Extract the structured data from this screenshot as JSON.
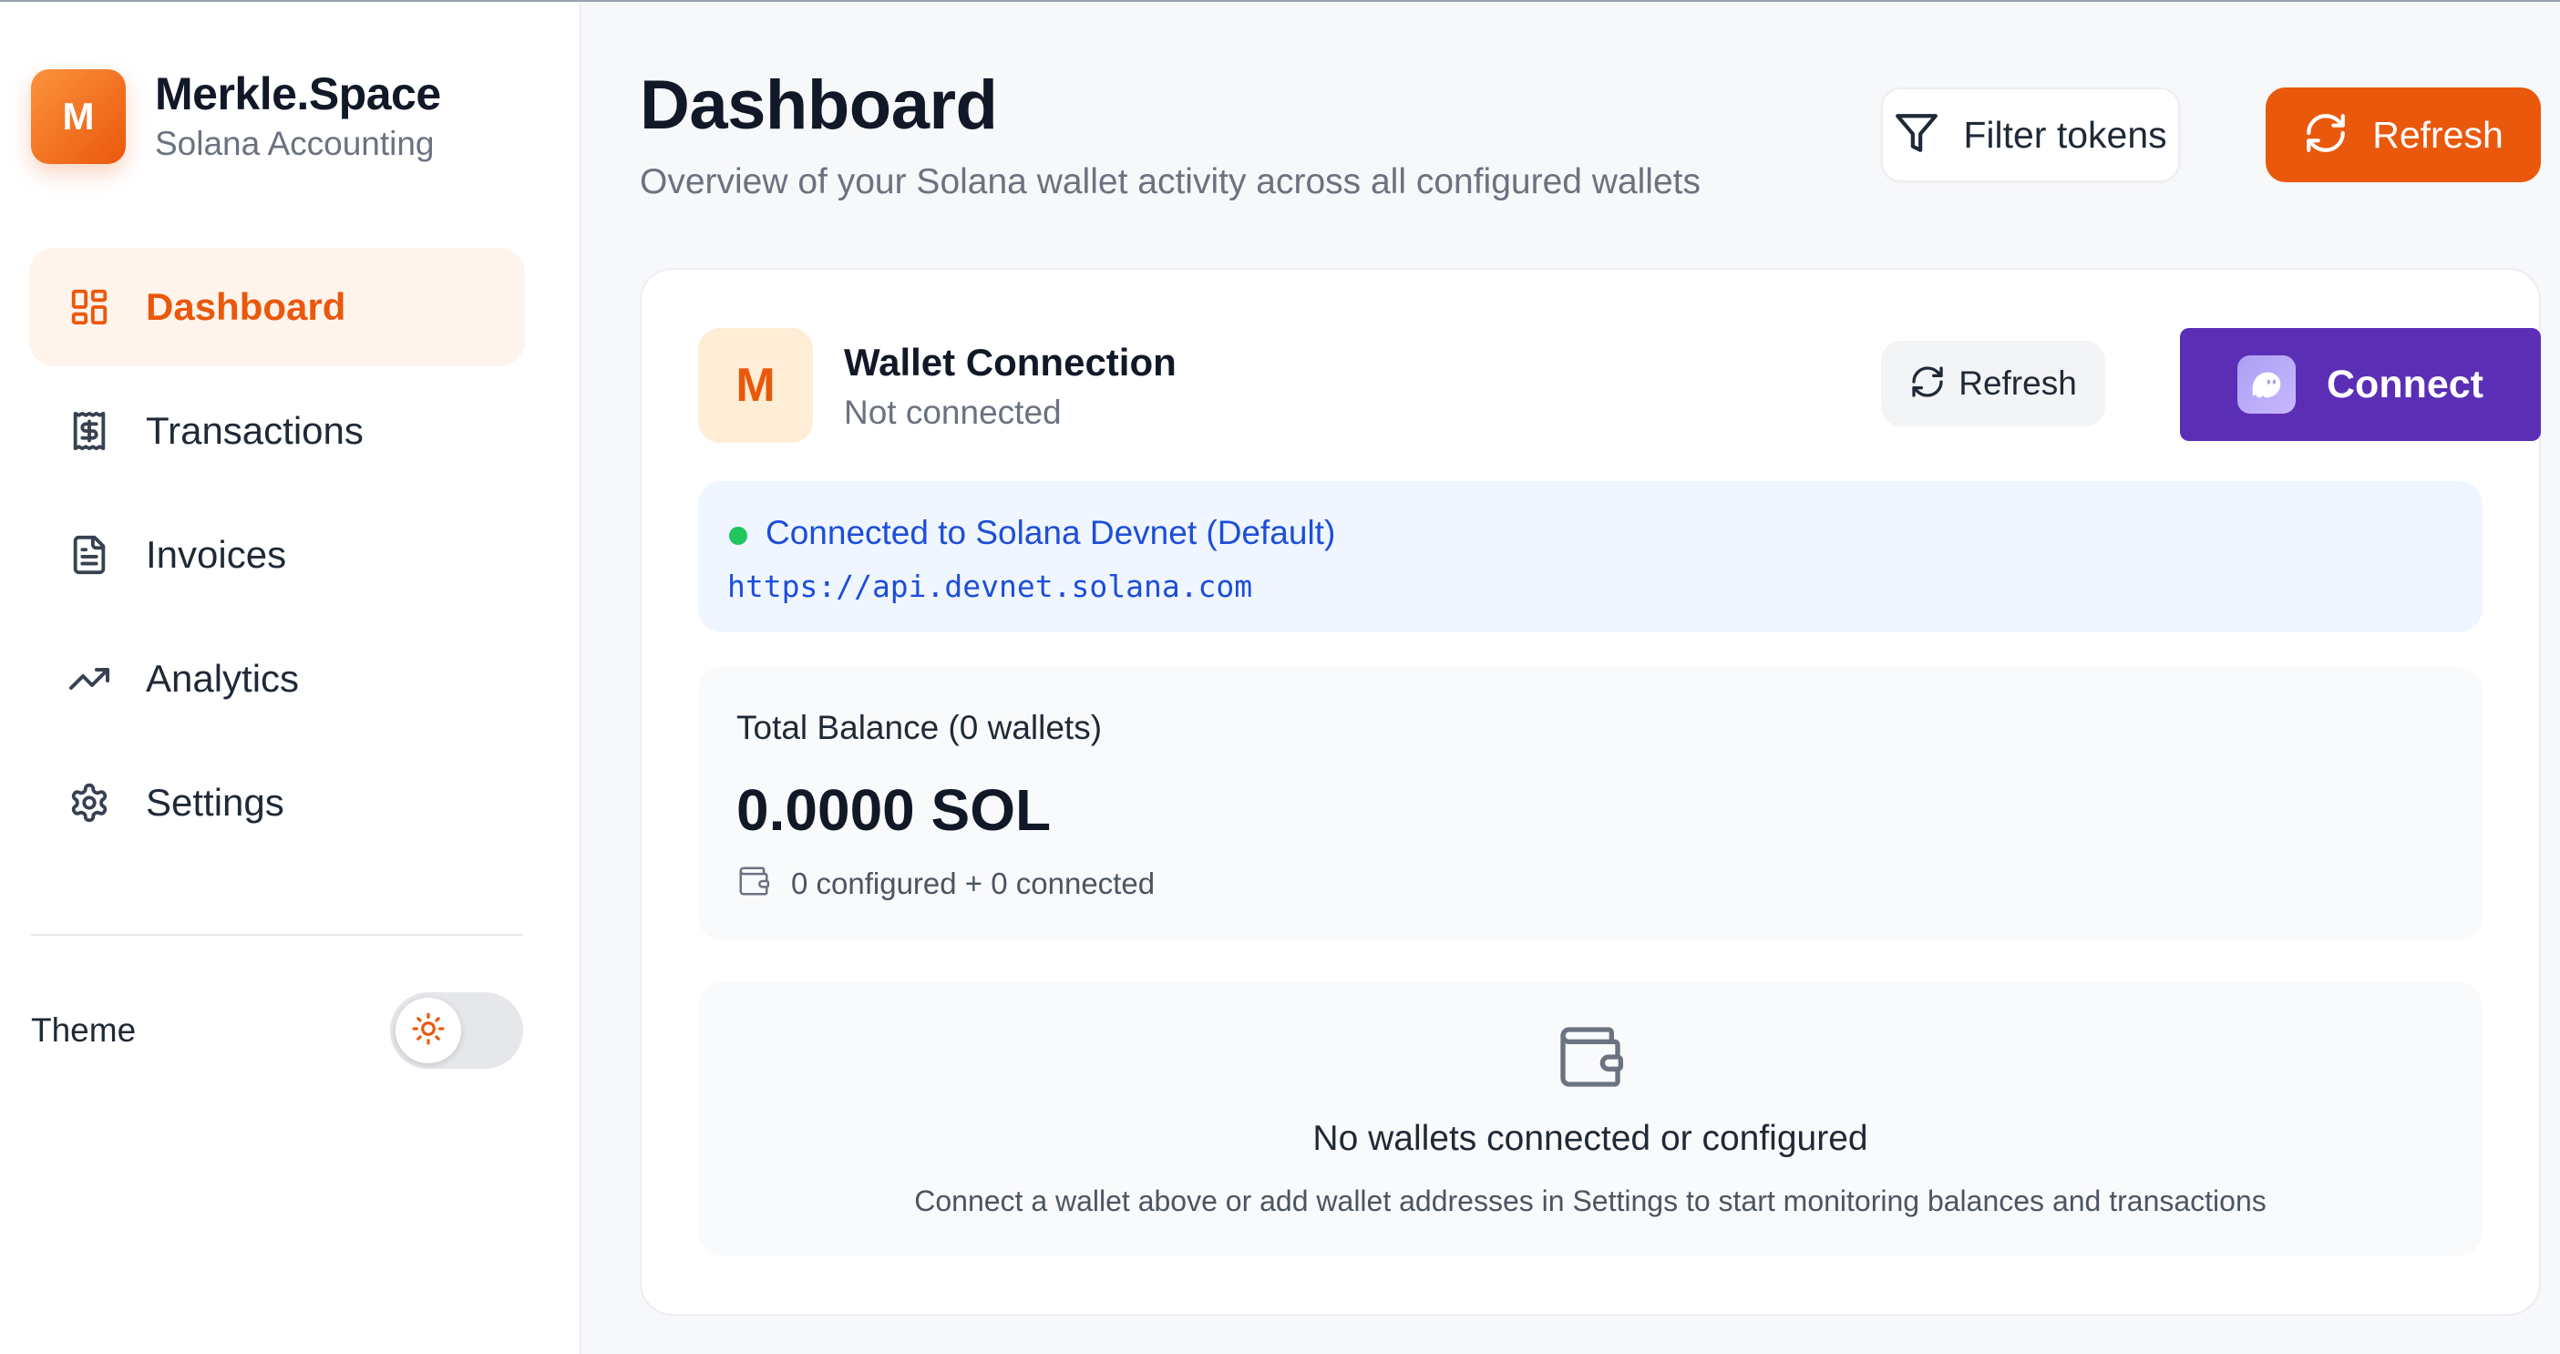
{
  "brand": {
    "logo_letter": "M",
    "title": "Merkle.Space",
    "subtitle": "Solana Accounting"
  },
  "sidebar": {
    "items": [
      {
        "label": "Dashboard",
        "icon": "dashboard-grid-icon",
        "active": true
      },
      {
        "label": "Transactions",
        "icon": "receipt-dollar-icon",
        "active": false
      },
      {
        "label": "Invoices",
        "icon": "document-icon",
        "active": false
      },
      {
        "label": "Analytics",
        "icon": "trending-up-icon",
        "active": false
      },
      {
        "label": "Settings",
        "icon": "gear-icon",
        "active": false
      }
    ],
    "theme_label": "Theme",
    "theme_icon": "sun-icon"
  },
  "header": {
    "title": "Dashboard",
    "subtitle": "Overview of your Solana wallet activity across all configured wallets",
    "filter_label": "Filter tokens",
    "refresh_label": "Refresh"
  },
  "wallet": {
    "avatar_letter": "M",
    "title": "Wallet Connection",
    "status": "Not connected",
    "refresh_label": "Refresh",
    "connect_label": "Connect"
  },
  "network": {
    "name": "Connected to Solana Devnet (Default)",
    "url": "https://api.devnet.solana.com",
    "status_color": "#22c55e"
  },
  "balance": {
    "label": "Total Balance (0 wallets)",
    "value": "0.0000 SOL",
    "meta": "0 configured + 0 connected"
  },
  "empty": {
    "title": "No wallets connected or configured",
    "text": "Connect a wallet above or add wallet addresses in Settings to start monitoring balances and transactions"
  },
  "colors": {
    "accent": "#ea580c",
    "connect": "#5b2fb5",
    "link": "#1d4ed8"
  }
}
